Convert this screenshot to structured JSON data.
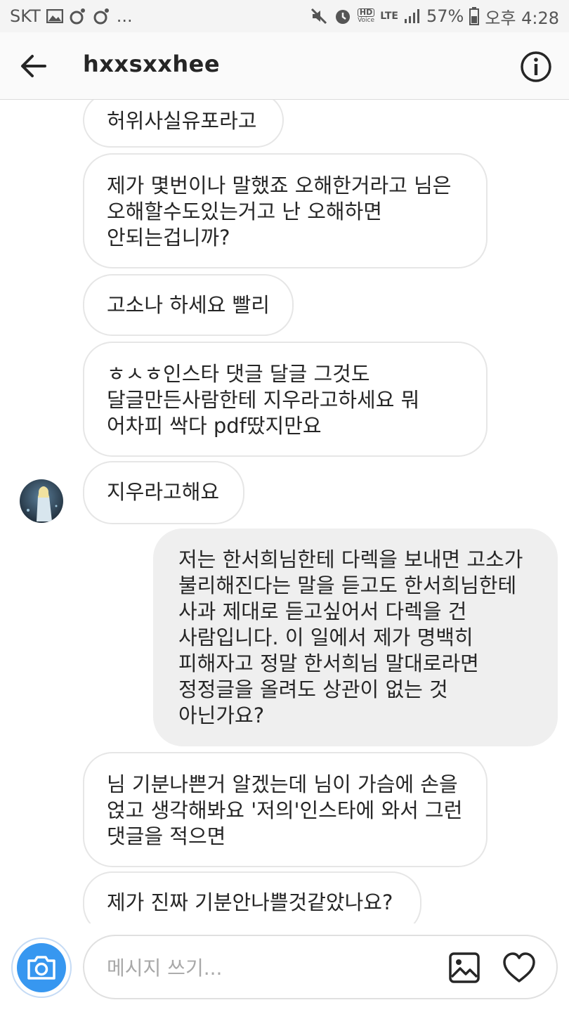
{
  "status_bar": {
    "carrier": "SKT",
    "more": "...",
    "network": "LTE",
    "hd_voice_top": "HD",
    "hd_voice_bottom": "Voice",
    "battery": "57%",
    "time": "오후 4:28",
    "icons": [
      "image-icon",
      "record-icon",
      "record-icon",
      "mute-icon",
      "alarm-icon",
      "hd-voice-icon",
      "signal-icon",
      "battery-icon"
    ]
  },
  "header": {
    "title": "hxxsxxhee",
    "back_icon": "arrow-left-icon",
    "info_icon": "info-icon"
  },
  "messages": [
    {
      "sender": "other",
      "text": "허위사실유포라고"
    },
    {
      "sender": "other",
      "text": "제가 몇번이나 말했죠 오해한거라고 님은\n오해할수도있는거고 난 오해하면\n안되는겁니까?"
    },
    {
      "sender": "other",
      "text": "고소나 하세요 빨리"
    },
    {
      "sender": "other",
      "text": "ㅎㅅㅎ인스타 댓글 달글 그것도\n달글만든사람한테 지우라고하세요 뭐\n어차피 싹다 pdf땄지만요"
    },
    {
      "sender": "other",
      "text": "지우라고해요"
    },
    {
      "sender": "me",
      "text": "저는 한서희님한테 다렉을 보내면 고소가\n불리해진다는 말을 듣고도 한서희님한테\n사과 제대로 듣고싶어서 다렉을 건\n사람입니다. 이 일에서 제가 명백히\n피해자고 정말 한서희님 말대로라면\n정정글을 올려도 상관이 없는 것\n아닌가요?"
    },
    {
      "sender": "other",
      "text": "님 기분나쁜거 알겠는데 님이 가슴에 손을\n얹고 생각해봐요 '저의'인스타에 와서 그런\n댓글을 적으면"
    },
    {
      "sender": "other",
      "text": "제가 진짜 기분안나쁠것같았나요?"
    }
  ],
  "composer": {
    "placeholder": "메시지 쓰기...",
    "camera_icon": "camera-icon",
    "gallery_icon": "gallery-icon",
    "heart_icon": "heart-icon"
  },
  "colors": {
    "accent": "#3797f0",
    "my_bubble": "#efefef",
    "bubble_border": "#e6e6e6"
  }
}
